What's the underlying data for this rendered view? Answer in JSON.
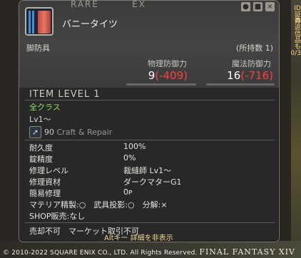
{
  "background": {
    "right_text": [
      "ID",
      "証算",
      "の",
      "返",
      "信",
      "品",
      "も",
      "0/3"
    ]
  },
  "item": {
    "rarity_label": "RARE",
    "tag_label": "EX",
    "name": "バニータイツ",
    "category": "脚防具",
    "owned": "(所持数 1)",
    "top_icons": [
      "pin-icon",
      "lock-icon",
      "close-icon"
    ]
  },
  "stats": {
    "physical_label": "物理防御力",
    "physical_value": "9",
    "physical_diff": "(-409)",
    "magic_label": "魔法防御力",
    "magic_value": "16",
    "magic_diff": "(-716)"
  },
  "item_level": "ITEM LEVEL 1",
  "classes": "全クラス",
  "level_req": "Lv1～",
  "craft": {
    "value": "90",
    "label": "Craft & Repair"
  },
  "specs": [
    {
      "label": "耐久度",
      "value": "100%"
    },
    {
      "label": "錠精度",
      "value": "0%"
    },
    {
      "label": "修理レベル",
      "value": "裁縫師 Lv1～"
    },
    {
      "label": "修理資材",
      "value": "ダークマターG1"
    },
    {
      "label": "簡易修理",
      "value": "0ᴘ"
    }
  ],
  "flags": {
    "materia": "マテリア精製:○　武具投影:○　分解:×",
    "shop": "SHOP販売:なし",
    "trade": "売却不可　マーケット取引不可"
  },
  "hint": "Altキー 詳細を非表示",
  "footer": {
    "copyright": "© 2010-2022 SQUARE ENIX CO., LTD. All Rights Reserved.",
    "logo": "FINAL FANTASY XIV"
  }
}
